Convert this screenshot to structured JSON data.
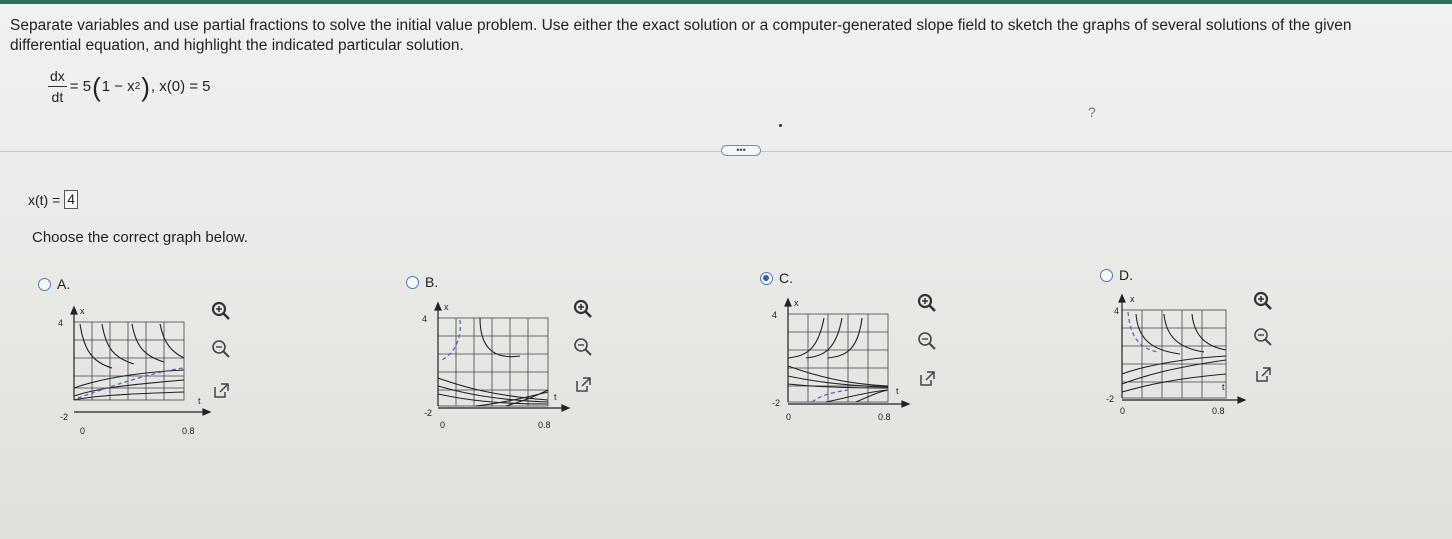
{
  "question": "Separate variables and use partial fractions to solve the initial value problem. Use either the exact solution or a computer-generated slope field to sketch the graphs of several solutions of the given differential equation, and highlight the indicated particular solution.",
  "equation": {
    "numerator": "dx",
    "denominator": "dt",
    "rhs_prefix": "= 5",
    "rhs_inner": "1 − x",
    "exponent": "2",
    "condition": ", x(0) = 5"
  },
  "help_mark": "?",
  "more_button": "•••",
  "answer": {
    "label": "x(t) =",
    "value": "4"
  },
  "prompt": "Choose the correct graph below.",
  "options": [
    {
      "letter": "A.",
      "selected": false,
      "y_top": "4",
      "y_bottom": "-2",
      "x_origin": "0",
      "x_tick": "0.8",
      "x_axis": "t",
      "y_axis": "x"
    },
    {
      "letter": "B.",
      "selected": false,
      "y_top": "4",
      "y_bottom": "-2",
      "x_origin": "0",
      "x_tick": "0.8",
      "x_axis": "t",
      "y_axis": "x"
    },
    {
      "letter": "C.",
      "selected": true,
      "y_top": "4",
      "y_bottom": "-2",
      "x_origin": "0",
      "x_tick": "0.8",
      "x_axis": "t",
      "y_axis": "x"
    },
    {
      "letter": "D.",
      "selected": false,
      "y_top": "4",
      "y_bottom": "-2",
      "x_origin": "0",
      "x_tick": "0.8",
      "x_axis": "t",
      "y_axis": "x"
    }
  ],
  "icons": [
    "zoom-in-icon",
    "zoom-out-icon",
    "open-external-icon"
  ],
  "colors": {
    "accent": "#2f5fb0",
    "curve": "#222222",
    "highlight": "#5a64c8",
    "grid": "#444444"
  }
}
